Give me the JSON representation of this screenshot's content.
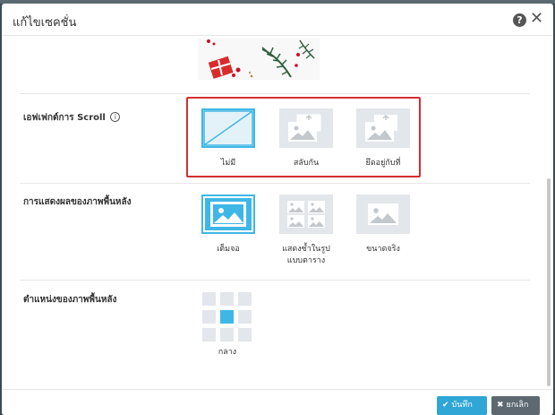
{
  "dialog": {
    "title": "แก้ไขเซคชั่น",
    "help_glyph": "?",
    "close_glyph": "✕"
  },
  "scroll_effect": {
    "label": "เอฟเฟกต์การ Scroll",
    "info_glyph": "i",
    "options": [
      {
        "label": "ไม่มี",
        "icon": "no-effect-icon",
        "selected": true
      },
      {
        "label": "สลับกัน",
        "icon": "parallax-image-icon",
        "selected": false
      },
      {
        "label": "ยึดอยู่กับที่",
        "icon": "fixed-image-icon",
        "selected": false
      }
    ]
  },
  "background_display": {
    "label": "การแสดงผลของภาพพื้นหลัง",
    "options": [
      {
        "label": "เต็มจอ",
        "icon": "image-icon",
        "selected": true
      },
      {
        "label": "แสดงซ้ำในรูปแบบตาราง",
        "line1": "แสดงซ้ำในรูป",
        "line2": "แบบตาราง",
        "icon": "tiled-image-icon",
        "selected": false
      },
      {
        "label": "ขนาดจริง",
        "icon": "image-icon",
        "selected": false
      }
    ]
  },
  "background_position": {
    "label": "ตำแหน่งของภาพพื้นหลัง",
    "selected_label": "กลาง",
    "selected_index": 4
  },
  "footer": {
    "save_label": "บันทึก",
    "save_glyph": "✔",
    "cancel_label": "ยกเลิก",
    "cancel_glyph": "✖"
  },
  "colors": {
    "accent": "#3fb7e6",
    "highlight": "#d32f2f",
    "tile": "#e3e6ea",
    "cancel": "#5d6870"
  }
}
